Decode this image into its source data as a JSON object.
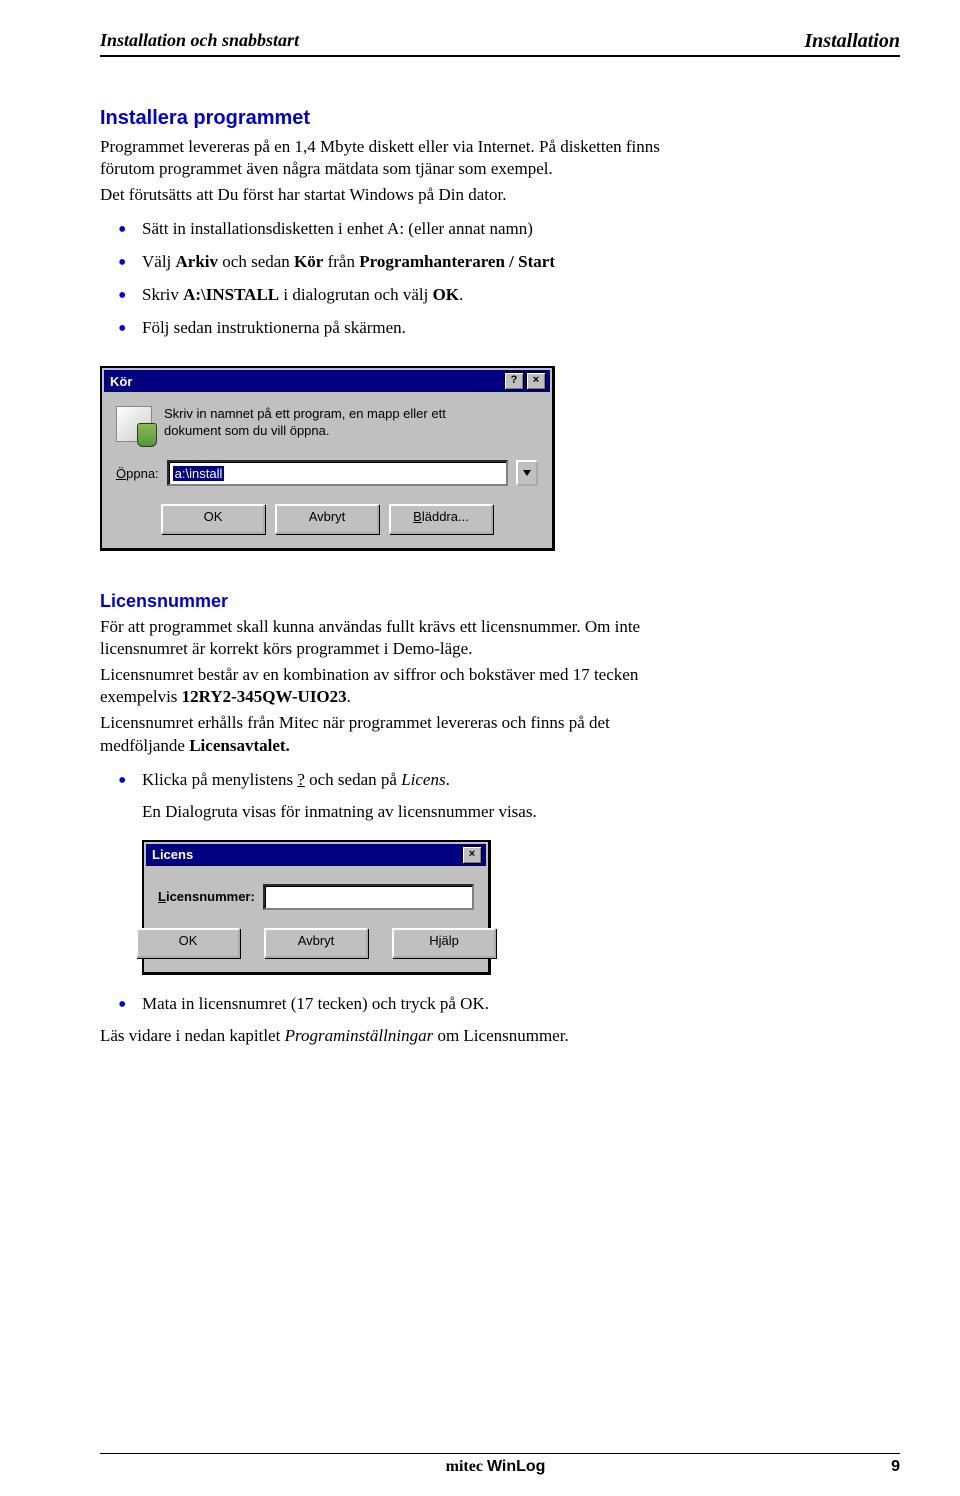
{
  "header": {
    "left": "Installation och snabbstart",
    "right": "Installation"
  },
  "section1": {
    "title": "Installera programmet",
    "p1": "Programmet levereras på en 1,4 Mbyte diskett eller via Internet. På disketten finns förutom programmet även några mätdata som tjänar som exempel.",
    "p2": "Det förutsätts att Du först har startat Windows på Din dator.",
    "b1": "Sätt in installationsdisketten i enhet A: (eller annat namn)",
    "b2_pre": "Välj ",
    "b2_bold1": "Arkiv",
    "b2_mid1": " och sedan ",
    "b2_bold2": "Kör",
    "b2_mid2": " från ",
    "b2_bold3": "Programhanteraren / Start",
    "b3_pre": "Skriv ",
    "b3_bold1": "A:\\INSTALL",
    "b3_mid": " i dialogrutan och välj ",
    "b3_bold2": "OK",
    "b3_post": ".",
    "b4": "Följ sedan instruktionerna på skärmen."
  },
  "kor_dialog": {
    "title": "Kör",
    "desc": "Skriv in namnet på ett program, en mapp eller ett dokument som du vill öppna.",
    "open_label_u": "Ö",
    "open_label_rest": "ppna:",
    "open_value": "a:\\install",
    "btn_ok": "OK",
    "btn_cancel": "Avbryt",
    "btn_browse_u": "B",
    "btn_browse_rest": "läddra..."
  },
  "section2": {
    "title": "Licensnummer",
    "p1": "För att programmet skall kunna användas fullt krävs ett licensnummer. Om inte licensnumret är korrekt körs programmet i Demo-läge.",
    "p2_pre": "Licensnumret består av en kombination av siffror och bokstäver med 17 tecken exempelvis ",
    "p2_bold": "12RY2-345QW-UIO23",
    "p2_post": ".",
    "p3_pre": "Licensnumret erhålls från Mitec när programmet levereras och finns på det medföljande ",
    "p3_bold": "Licensavtalet.",
    "b1_pre": "Klicka på menylistens ",
    "b1_u": "?",
    "b1_mid": " och sedan på ",
    "b1_i": "Licens",
    "b1_post": ".",
    "sub1": "En Dialogruta visas för inmatning av licensnummer visas.",
    "b2": "Mata in licensnumret (17 tecken) och tryck på OK.",
    "p4_pre": "Läs vidare i nedan kapitlet ",
    "p4_i": "Programinställningar",
    "p4_post": " om Licensnummer."
  },
  "licens_dialog": {
    "title": "Licens",
    "label_u": "L",
    "label_rest": "icensnummer:",
    "value": "",
    "btn_ok": "OK",
    "btn_cancel": "Avbryt",
    "btn_help": "Hjälp"
  },
  "footer": {
    "brand_prefix": "mitec ",
    "brand_product": "WinLog",
    "page_number": "9"
  }
}
